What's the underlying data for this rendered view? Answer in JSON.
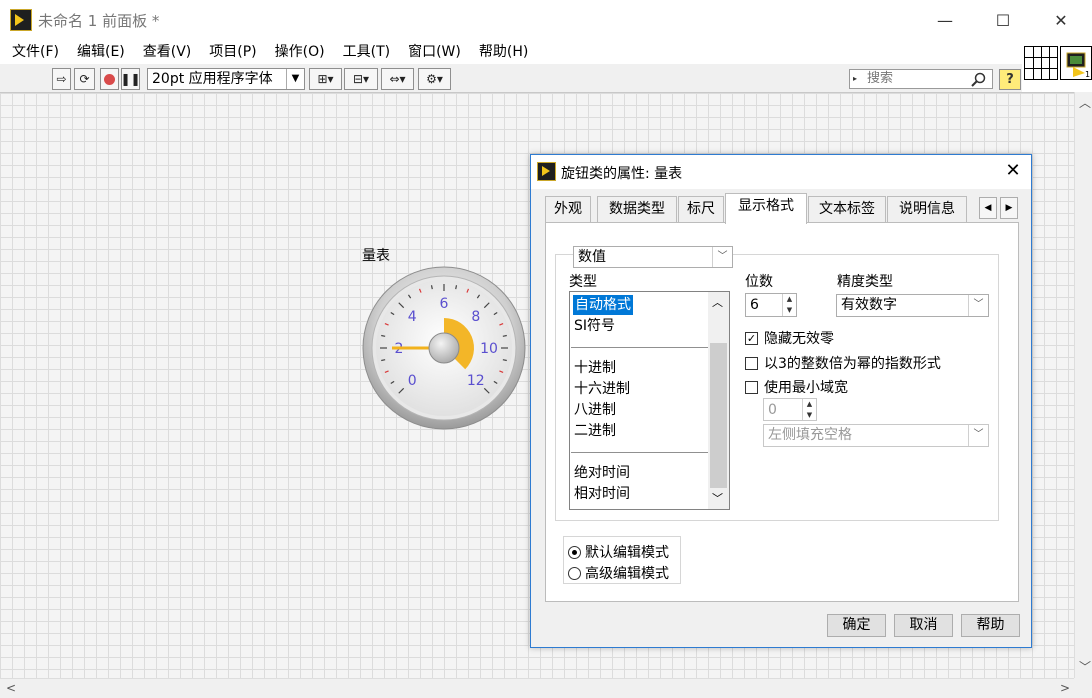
{
  "window": {
    "title": "未命名 1 前面板 *",
    "minimize": "—",
    "maximize": "☐",
    "close": "✕"
  },
  "menu": [
    "文件(F)",
    "编辑(E)",
    "查看(V)",
    "项目(P)",
    "操作(O)",
    "工具(T)",
    "窗口(W)",
    "帮助(H)"
  ],
  "toolbar": {
    "font": "20pt 应用程序字体",
    "search_placeholder": "搜索",
    "help": "?"
  },
  "gauge": {
    "label": "量表",
    "ticks": [
      "0",
      "2",
      "4",
      "6",
      "8",
      "10",
      "12"
    ],
    "value": 2,
    "colors": {
      "accent": "#f2b21c",
      "ticks": "#5a4fcf",
      "red_marks": "#d93a3a"
    }
  },
  "dialog": {
    "title": "旋钮类的属性: 量表",
    "close": "✕",
    "tabs": [
      "外观",
      "数据类型",
      "标尺",
      "显示格式",
      "文本标签",
      "说明信息"
    ],
    "active_tab": "显示格式",
    "tab_scroll_left": "◀",
    "tab_scroll_right": "▶",
    "category_select": "数值",
    "type_label": "类型",
    "type_list": [
      "自动格式",
      "SI符号",
      "十进制",
      "十六进制",
      "八进制",
      "二进制",
      "绝对时间",
      "相对时间"
    ],
    "selected_type": "自动格式",
    "digits_label": "位数",
    "digits_value": "6",
    "precision_label": "精度类型",
    "precision_value": "有效数字",
    "hide_zeros": {
      "label": "隐藏无效零",
      "checked": true
    },
    "exp_multiple3": {
      "label": "以3的整数倍为幂的指数形式",
      "checked": false
    },
    "min_width": {
      "label": "使用最小域宽",
      "checked": false
    },
    "min_width_value": "0",
    "padding_value": "左侧填充空格",
    "edit_mode_default": "默认编辑模式",
    "edit_mode_advanced": "高级编辑模式",
    "buttons": {
      "ok": "确定",
      "cancel": "取消",
      "help": "帮助"
    }
  }
}
